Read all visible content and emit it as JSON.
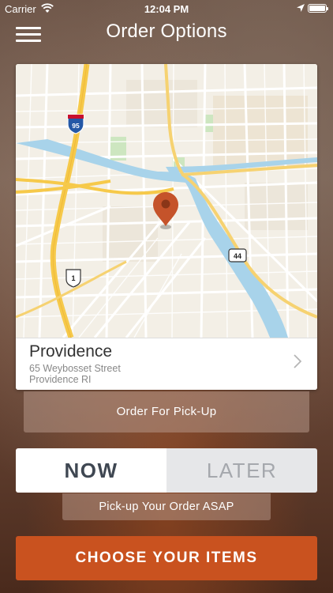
{
  "status_bar": {
    "carrier": "Carrier",
    "time": "12:04 PM"
  },
  "nav": {
    "title": "Order Options"
  },
  "map": {
    "shields": {
      "interstate": "95",
      "us_route": "1",
      "state_route": "44"
    }
  },
  "location": {
    "name": "Providence",
    "street": "65 Weybosset Street",
    "city": "Providence RI"
  },
  "order_type_label": "Order For Pick-Up",
  "timing": {
    "now_label": "NOW",
    "later_label": "LATER",
    "selected": "NOW"
  },
  "timing_note": "Pick-up Your Order ASAP",
  "cta_label": "CHOOSE YOUR ITEMS",
  "colors": {
    "accent": "#c9521f",
    "pin": "#c5532a",
    "river": "#a8d3ea",
    "highway": "#f6c94a"
  },
  "icons": {
    "menu": "hamburger-icon",
    "pin": "map-pin-icon",
    "chevron": "chevron-right-icon"
  }
}
